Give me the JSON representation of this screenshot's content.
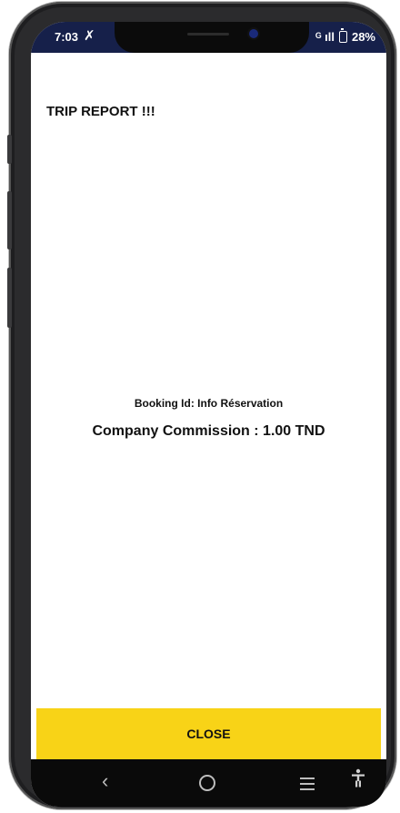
{
  "status_bar": {
    "time": "7:03",
    "left_icon": "✗",
    "network": "ᴳ ıll",
    "battery": "28%"
  },
  "trip_report": {
    "title": "TRIP REPORT !!!",
    "booking_id": "Booking Id: Info Réservation",
    "commission": "Company Commission : 1.00 TND",
    "close_label": "CLOSE"
  },
  "nav_bar": {
    "back": "‹",
    "accessibility": "♀"
  },
  "colors": {
    "status_bar_bg": "#16204a",
    "close_button_bg": "#f8d317",
    "nav_bar_bg": "#0a0a0a"
  }
}
